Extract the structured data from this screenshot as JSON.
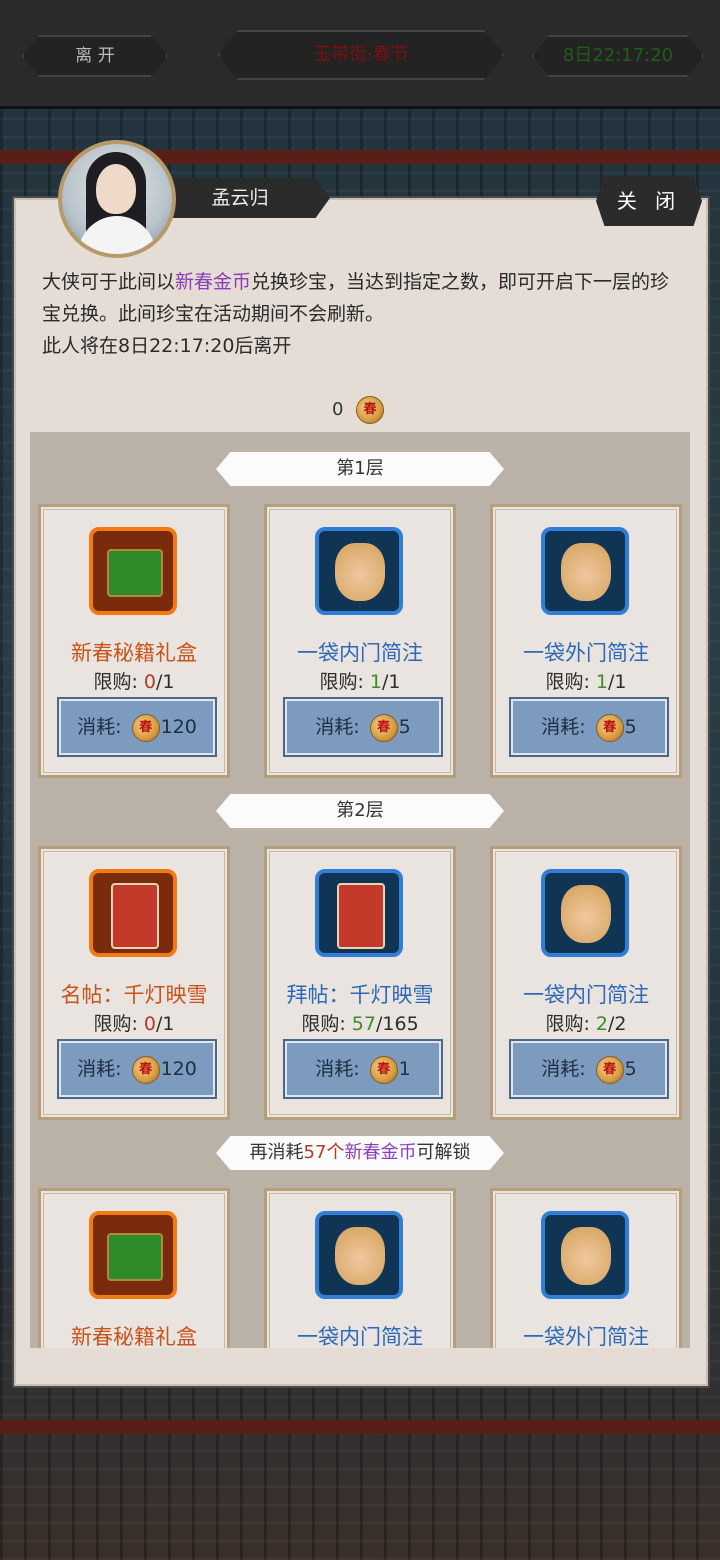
{
  "topbar": {
    "leave_label": "离 开",
    "location": "玉带街·春节",
    "timer": "8日22:17:20"
  },
  "npc": {
    "name": "孟云归",
    "close_label": "关 闭"
  },
  "description": {
    "line1_a": "大侠可于此间以",
    "line1_highlight": "新春金币",
    "line1_b": "兑换珍宝，当达到指定之数，即可开启下一层的珍宝兑换。此间珍宝在活动期间不会刷新。",
    "line2": "此人将在8日22:17:20后离开"
  },
  "balance": {
    "amount": "0",
    "currency_icon": "coin-icon",
    "coin_char": "春"
  },
  "tiers": [
    {
      "label": "第1层",
      "items": [
        {
          "name": "新春秘籍礼盒",
          "name_color": "orange",
          "limit_prefix": "限购: ",
          "limit_used": "0",
          "limit_total": "/1",
          "used_color": "red",
          "cost_label": "消耗: ",
          "cost": "120",
          "icon": "chest-icon",
          "frame": "orange"
        },
        {
          "name": "一袋内门简注",
          "name_color": "blue",
          "limit_prefix": "限购: ",
          "limit_used": "1",
          "limit_total": "/1",
          "used_color": "green",
          "cost_label": "消耗: ",
          "cost": "5",
          "icon": "bag-icon",
          "frame": "blue"
        },
        {
          "name": "一袋外门简注",
          "name_color": "blue",
          "limit_prefix": "限购: ",
          "limit_used": "1",
          "limit_total": "/1",
          "used_color": "green",
          "cost_label": "消耗: ",
          "cost": "5",
          "icon": "bag-icon",
          "frame": "blue"
        }
      ]
    },
    {
      "label": "第2层",
      "items": [
        {
          "name": "名帖：千灯映雪",
          "name_color": "orange",
          "limit_prefix": "限购: ",
          "limit_used": "0",
          "limit_total": "/1",
          "used_color": "red",
          "cost_label": "消耗: ",
          "cost": "120",
          "icon": "invitation-card-icon",
          "frame": "orange"
        },
        {
          "name": "拜帖：千灯映雪",
          "name_color": "blue",
          "limit_prefix": "限购: ",
          "limit_used": "57",
          "limit_total": "/165",
          "used_color": "green",
          "cost_label": "消耗: ",
          "cost": "1",
          "icon": "invitation-card-icon",
          "frame": "blue"
        },
        {
          "name": "一袋内门简注",
          "name_color": "blue",
          "limit_prefix": "限购: ",
          "limit_used": "2",
          "limit_total": "/2",
          "used_color": "green",
          "cost_label": "消耗: ",
          "cost": "5",
          "icon": "bag-icon",
          "frame": "blue"
        }
      ]
    },
    {
      "unlock_a": "再消耗",
      "unlock_count": "57个",
      "unlock_currency": "新春金币",
      "unlock_b": "可解锁",
      "items": [
        {
          "name": "新春秘籍礼盒",
          "name_color": "orange",
          "icon": "chest-icon",
          "frame": "orange"
        },
        {
          "name": "一袋内门简注",
          "name_color": "blue",
          "icon": "bag-icon",
          "frame": "blue"
        },
        {
          "name": "一袋外门简注",
          "name_color": "blue",
          "icon": "bag-icon",
          "frame": "blue"
        }
      ]
    }
  ]
}
